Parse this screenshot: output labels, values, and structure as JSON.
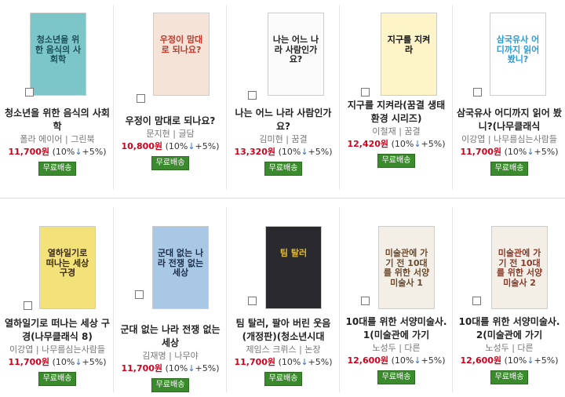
{
  "rows": [
    [
      {
        "title": "청소년을 위한 음식의 사회학",
        "cover_text": "청소년을 위한 음식의 사회학",
        "cover_bg": "#7cc6c9",
        "cover_fg": "#1b4e58",
        "meta": "폴라 에이어 | 그린북",
        "price": "11,700원",
        "discount": "(10%",
        "point": "+5%)",
        "badge": "무료배송"
      },
      {
        "title": "우정이 맘대로 되나요?",
        "cover_text": "우정이 맘대로 되나요?",
        "cover_bg": "#f6e3d8",
        "cover_fg": "#c0392b",
        "meta": "문지현 | 글담",
        "price": "10,800원",
        "discount": "(10%",
        "point": "+5%)",
        "badge": "무료배송"
      },
      {
        "title": "나는 어느 나라 사람인가요?",
        "cover_text": "나는 어느 나라 사람인가요?",
        "cover_bg": "#fbfbfb",
        "cover_fg": "#222222",
        "meta": "김미현 | 꿈결",
        "price": "13,320원",
        "discount": "(10%",
        "point": "+5%)",
        "badge": "무료배송"
      },
      {
        "title": "지구를 지켜라(꿈결 생태 환경 시리즈)",
        "cover_text": "지구를 지켜라",
        "cover_bg": "#fdf4c7",
        "cover_fg": "#111111",
        "meta": "이철재 | 꿈결",
        "price": "12,420원",
        "discount": "(10%",
        "point": "+5%)",
        "badge": "무료배송"
      },
      {
        "title": "삼국유사 어디까지 읽어 봤니?(나무클래식",
        "cover_text": "삼국유사 어디까지 읽어 봤니?",
        "cover_bg": "#ffffff",
        "cover_fg": "#2a9bd6",
        "meta": "이강엽 | 나무를심는사람들",
        "price": "11,700원",
        "discount": "(10%",
        "point": "+5%)",
        "badge": "무료배송"
      }
    ],
    [
      {
        "title": "열하일기로 떠나는 세상 구경(나무클래식 8)",
        "cover_text": "열하일기로 떠나는 세상 구경",
        "cover_bg": "#f3e27a",
        "cover_fg": "#3b2a12",
        "meta": "이강엽 | 나무를심는사람들",
        "price": "11,700원",
        "discount": "(10%",
        "point": "+5%)",
        "badge": "무료배송"
      },
      {
        "title": "군대 없는 나라 전쟁 없는 세상",
        "cover_text": "군대 없는 나라 전쟁 없는 세상",
        "cover_bg": "#a9c8e6",
        "cover_fg": "#1c2f4a",
        "meta": "김재명 | 나무야",
        "price": "11,700원",
        "discount": "(10%",
        "point": "+5%)",
        "badge": "무료배송"
      },
      {
        "title": "팀 탈러, 팔아 버린 웃음(개정판)(청소년시대",
        "cover_text": "팀 탈러",
        "cover_bg": "#2a2a2e",
        "cover_fg": "#e5b92a",
        "meta": "제임스 크뤼스 | 논장",
        "price": "11,700원",
        "discount": "(10%",
        "point": "+5%)",
        "badge": "무료배송"
      },
      {
        "title": "10대를 위한 서양미술사. 1(미술관에 가기",
        "cover_text": "미술관에 가기 전 10대를 위한 서양미술사 1",
        "cover_bg": "#f4efe6",
        "cover_fg": "#6b4a2e",
        "meta": "노성두 | 다른",
        "price": "12,600원",
        "discount": "(10%",
        "point": "+5%)",
        "badge": "무료배송"
      },
      {
        "title": "10대를 위한 서양미술사. 2(미술관에 가기",
        "cover_text": "미술관에 가기 전 10대를 위한 서양미술사 2",
        "cover_bg": "#f4efe6",
        "cover_fg": "#8a3a2a",
        "meta": "노성두 | 다른",
        "price": "12,600원",
        "discount": "(10%",
        "point": "+5%)",
        "badge": "무료배송"
      }
    ]
  ]
}
